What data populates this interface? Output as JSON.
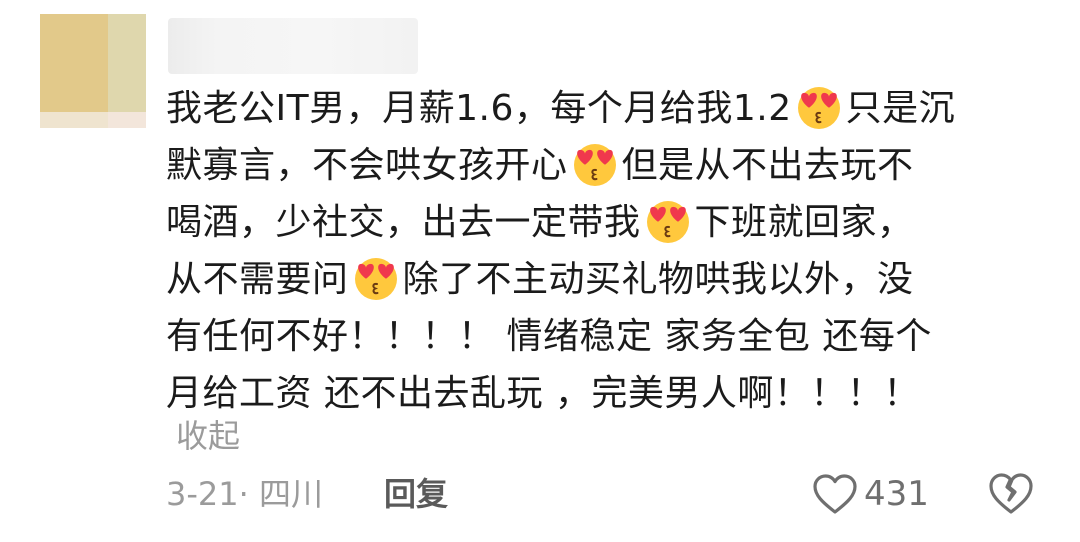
{
  "comment": {
    "lines": [
      {
        "segments": [
          "我老公IT男，月薪1.6，每个月给我1.2",
          "只是沉"
        ],
        "emoji_after_first": true
      },
      {
        "segments": [
          "默寡言，不会哄女孩开心",
          "但是从不出去玩不"
        ],
        "emoji_after_first": true
      },
      {
        "segments": [
          "喝酒，少社交，出去一定带我",
          "下班就回家，"
        ],
        "emoji_after_first": true
      },
      {
        "segments": [
          "从不需要问",
          "除了不主动买礼物哄我以外，没"
        ],
        "emoji_after_first": true
      },
      {
        "segments": [
          "有任何不好！！！！ 情绪稳定 家务全包 还每个"
        ],
        "emoji_after_first": false
      },
      {
        "segments": [
          "月给工资 还不出去乱玩 ，完美男人啊！！！！"
        ],
        "emoji_after_first": false
      }
    ],
    "emoji_name": "heart-eyes-emoji"
  },
  "collapse_label": "收起",
  "meta": {
    "date_location": "3-21· 四川",
    "reply_label": "回复",
    "like_count": "431"
  },
  "colors": {
    "text": "#1b1b1b",
    "secondary": "#9b9b9b",
    "emoji_face": "#ffc83d",
    "emoji_heart": "#f0384d"
  },
  "icons": {
    "like": "heart-outline-icon",
    "dislike": "broken-heart-icon"
  }
}
